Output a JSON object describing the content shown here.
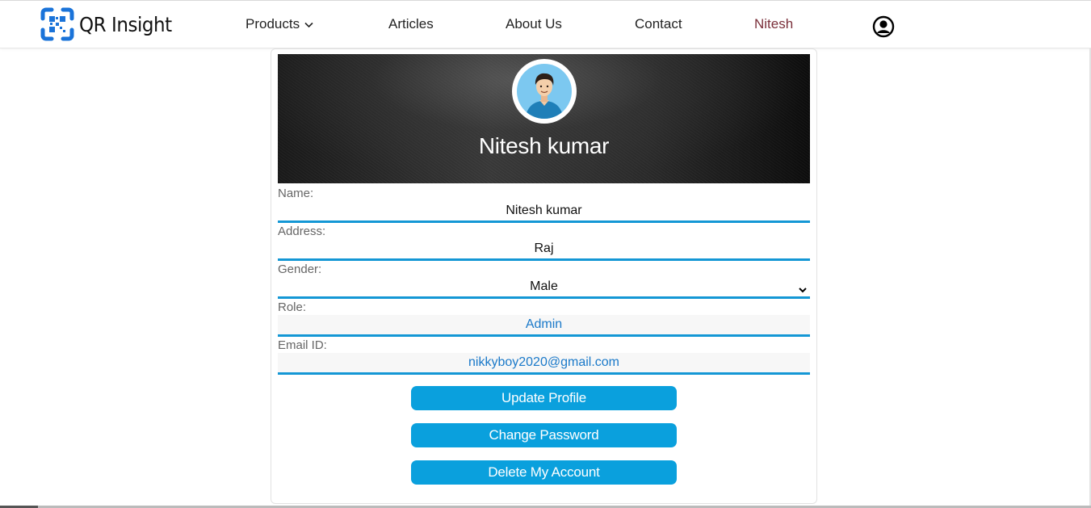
{
  "header": {
    "brand": "QR Insight",
    "nav": {
      "products": "Products",
      "articles": "Articles",
      "about": "About Us",
      "contact": "Contact",
      "user": "Nitesh"
    },
    "icons": {
      "logo": "qr-scan-logo-icon",
      "products_caret": "chevron-down-icon",
      "account": "user-circle-icon"
    }
  },
  "profile": {
    "display_name": "Nitesh kumar",
    "avatar": "male-avatar-illustration",
    "fields": {
      "name": {
        "label": "Name:",
        "value": "Nitesh kumar"
      },
      "address": {
        "label": "Address:",
        "value": "Raj"
      },
      "gender": {
        "label": "Gender:",
        "value": "Male"
      },
      "role": {
        "label": "Role:",
        "value": "Admin"
      },
      "email": {
        "label": "Email ID:",
        "value": "nikkyboy2020@gmail.com"
      }
    },
    "buttons": {
      "update": "Update Profile",
      "password": "Change Password",
      "delete": "Delete My Account"
    }
  },
  "colors": {
    "accent": "#0aa0dd",
    "field_underline": "#1497d5",
    "readonly_text": "#1a79c9",
    "user_nav": "#7a2f3a",
    "logo_blue": "#1a73d9"
  }
}
